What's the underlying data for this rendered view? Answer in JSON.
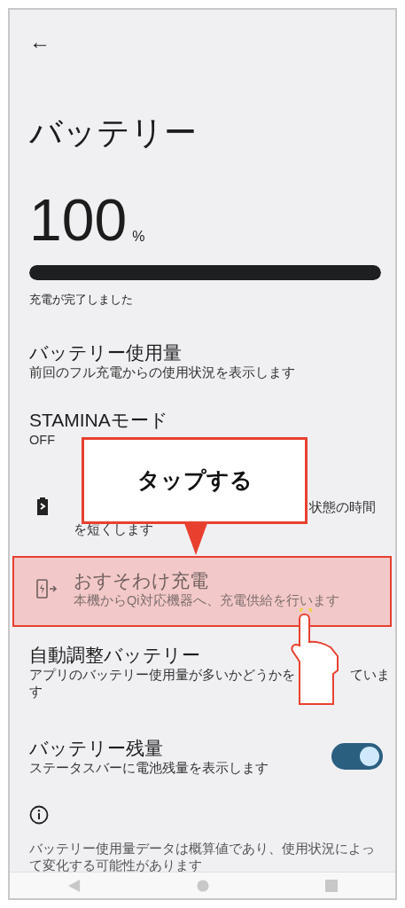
{
  "header": {
    "back": "←"
  },
  "title": "バッテリー",
  "battery": {
    "percent": "100",
    "unit": "%",
    "level": 1,
    "status": "充電が完了しました"
  },
  "items": [
    {
      "kind": "text",
      "title": "バッテリー使用量",
      "subtitle_parts": [
        "前回のフル充電からの使用状況を表示します"
      ]
    },
    {
      "kind": "text",
      "title": "STAMINAモード",
      "subtitle_parts": [
        "OFF"
      ]
    },
    {
      "kind": "icon",
      "subtitle_parts": [
        "状態の時間",
        "を短くします"
      ]
    },
    {
      "kind": "icon",
      "title": "おすそわけ充電",
      "subtitle_parts": [
        "本機からQi対応機器へ、充電供給を行います"
      ]
    },
    {
      "kind": "text",
      "title": "自動調整バッテリー",
      "subtitle_parts": [
        "アプリのバッテリー使用量が多いかどうかを",
        "ていま",
        "す"
      ]
    },
    {
      "kind": "toggle",
      "title": "バッテリー残量",
      "subtitle_parts": [
        "ステータスバーに電池残量を表示します"
      ],
      "on": true
    }
  ],
  "footer": {
    "note": "バッテリー使用量データは概算値であり、使用状況によって変化する可能性があります"
  },
  "annotation": {
    "callout": "タップする"
  }
}
